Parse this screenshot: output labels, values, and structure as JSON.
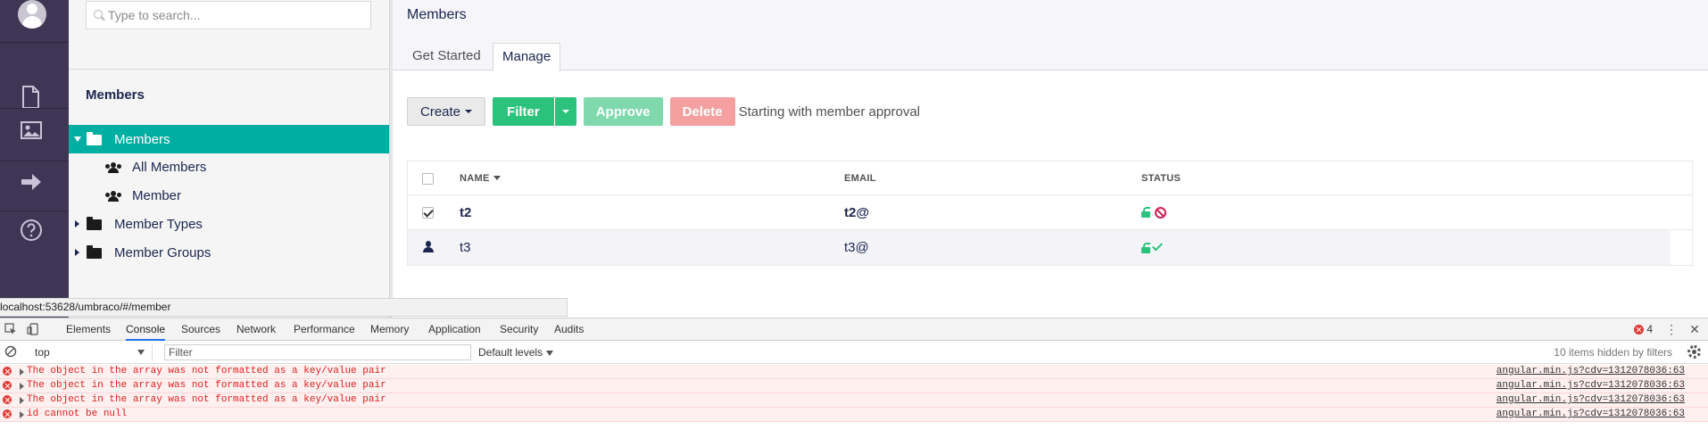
{
  "search": {
    "placeholder": "Type to search..."
  },
  "tree": {
    "title": "Members",
    "items": [
      {
        "label": "Members"
      },
      {
        "label": "All Members"
      },
      {
        "label": "Member"
      },
      {
        "label": "Member Types"
      },
      {
        "label": "Member Groups"
      }
    ]
  },
  "main": {
    "title": "Members",
    "tabs": [
      {
        "label": "Get Started"
      },
      {
        "label": "Manage"
      }
    ]
  },
  "toolbar": {
    "create_label": "Create",
    "filter_label": "Filter",
    "approve_label": "Approve",
    "delete_label": "Delete",
    "message": "Starting with member approval"
  },
  "table": {
    "columns": {
      "name": "NAME",
      "email": "EMAIL",
      "status": "STATUS"
    },
    "rows": [
      {
        "name": "t2",
        "email": "t2@",
        "checked": true,
        "status": "locked-open, disabled"
      },
      {
        "name": "t3",
        "email": "t3@",
        "checked": false,
        "status": "locked-open, approved"
      }
    ]
  },
  "status_url": "localhost:53628/umbraco/#/member",
  "devtools": {
    "tabs": [
      {
        "label": "Elements"
      },
      {
        "label": "Console"
      },
      {
        "label": "Sources"
      },
      {
        "label": "Network"
      },
      {
        "label": "Performance"
      },
      {
        "label": "Memory"
      },
      {
        "label": "Application"
      },
      {
        "label": "Security"
      },
      {
        "label": "Audits"
      }
    ],
    "error_count": "4",
    "context": "top",
    "filter_placeholder": "Filter",
    "levels": "Default levels",
    "hidden_items": "10 items hidden by filters",
    "logs": [
      {
        "message": "The object in the array was not formatted as a key/value pair",
        "source": "angular.min.js?cdv=1312078036:63"
      },
      {
        "message": "The object in the array was not formatted as a key/value pair",
        "source": "angular.min.js?cdv=1312078036:63"
      },
      {
        "message": "The object in the array was not formatted as a key/value pair",
        "source": "angular.min.js?cdv=1312078036:63"
      },
      {
        "message": "id cannot be null",
        "source": "angular.min.js?cdv=1312078036:63"
      }
    ]
  }
}
